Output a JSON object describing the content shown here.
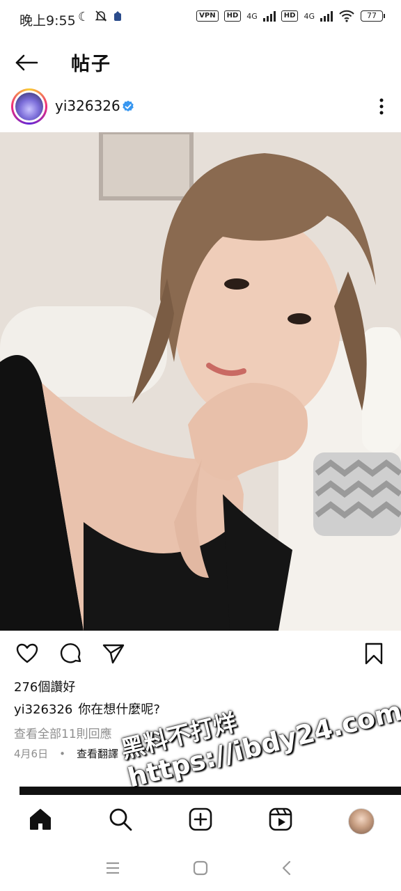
{
  "status_bar": {
    "time": "晚上9:55",
    "vpn": "VPN",
    "hd": "HD",
    "network": "4G",
    "battery": "77"
  },
  "header": {
    "title": "帖子"
  },
  "post": {
    "username": "yi326326",
    "likes": "276個讚好",
    "caption_user": "yi326326",
    "caption_text": "你在想什麼呢?",
    "view_comments": "查看全部11則回應",
    "date": "4月6日",
    "separator": "•",
    "translate": "查看翻譯"
  },
  "watermark": {
    "line1": "黑料不打烊",
    "line2": "https://ibdy24.com"
  },
  "icons": {
    "back": "back-arrow-icon",
    "verified": "verified-badge-icon",
    "more": "more-vertical-icon",
    "like": "heart-icon",
    "comment": "comment-icon",
    "share": "send-icon",
    "save": "bookmark-icon",
    "home": "home-icon",
    "search": "search-icon",
    "create": "plus-square-icon",
    "reels": "reels-icon",
    "sys_menu": "menu-icon",
    "sys_home": "square-icon",
    "sys_back": "chevron-left-icon"
  },
  "colors": {
    "verified": "#3897f0",
    "secondary_text": "#8e8e8e"
  }
}
